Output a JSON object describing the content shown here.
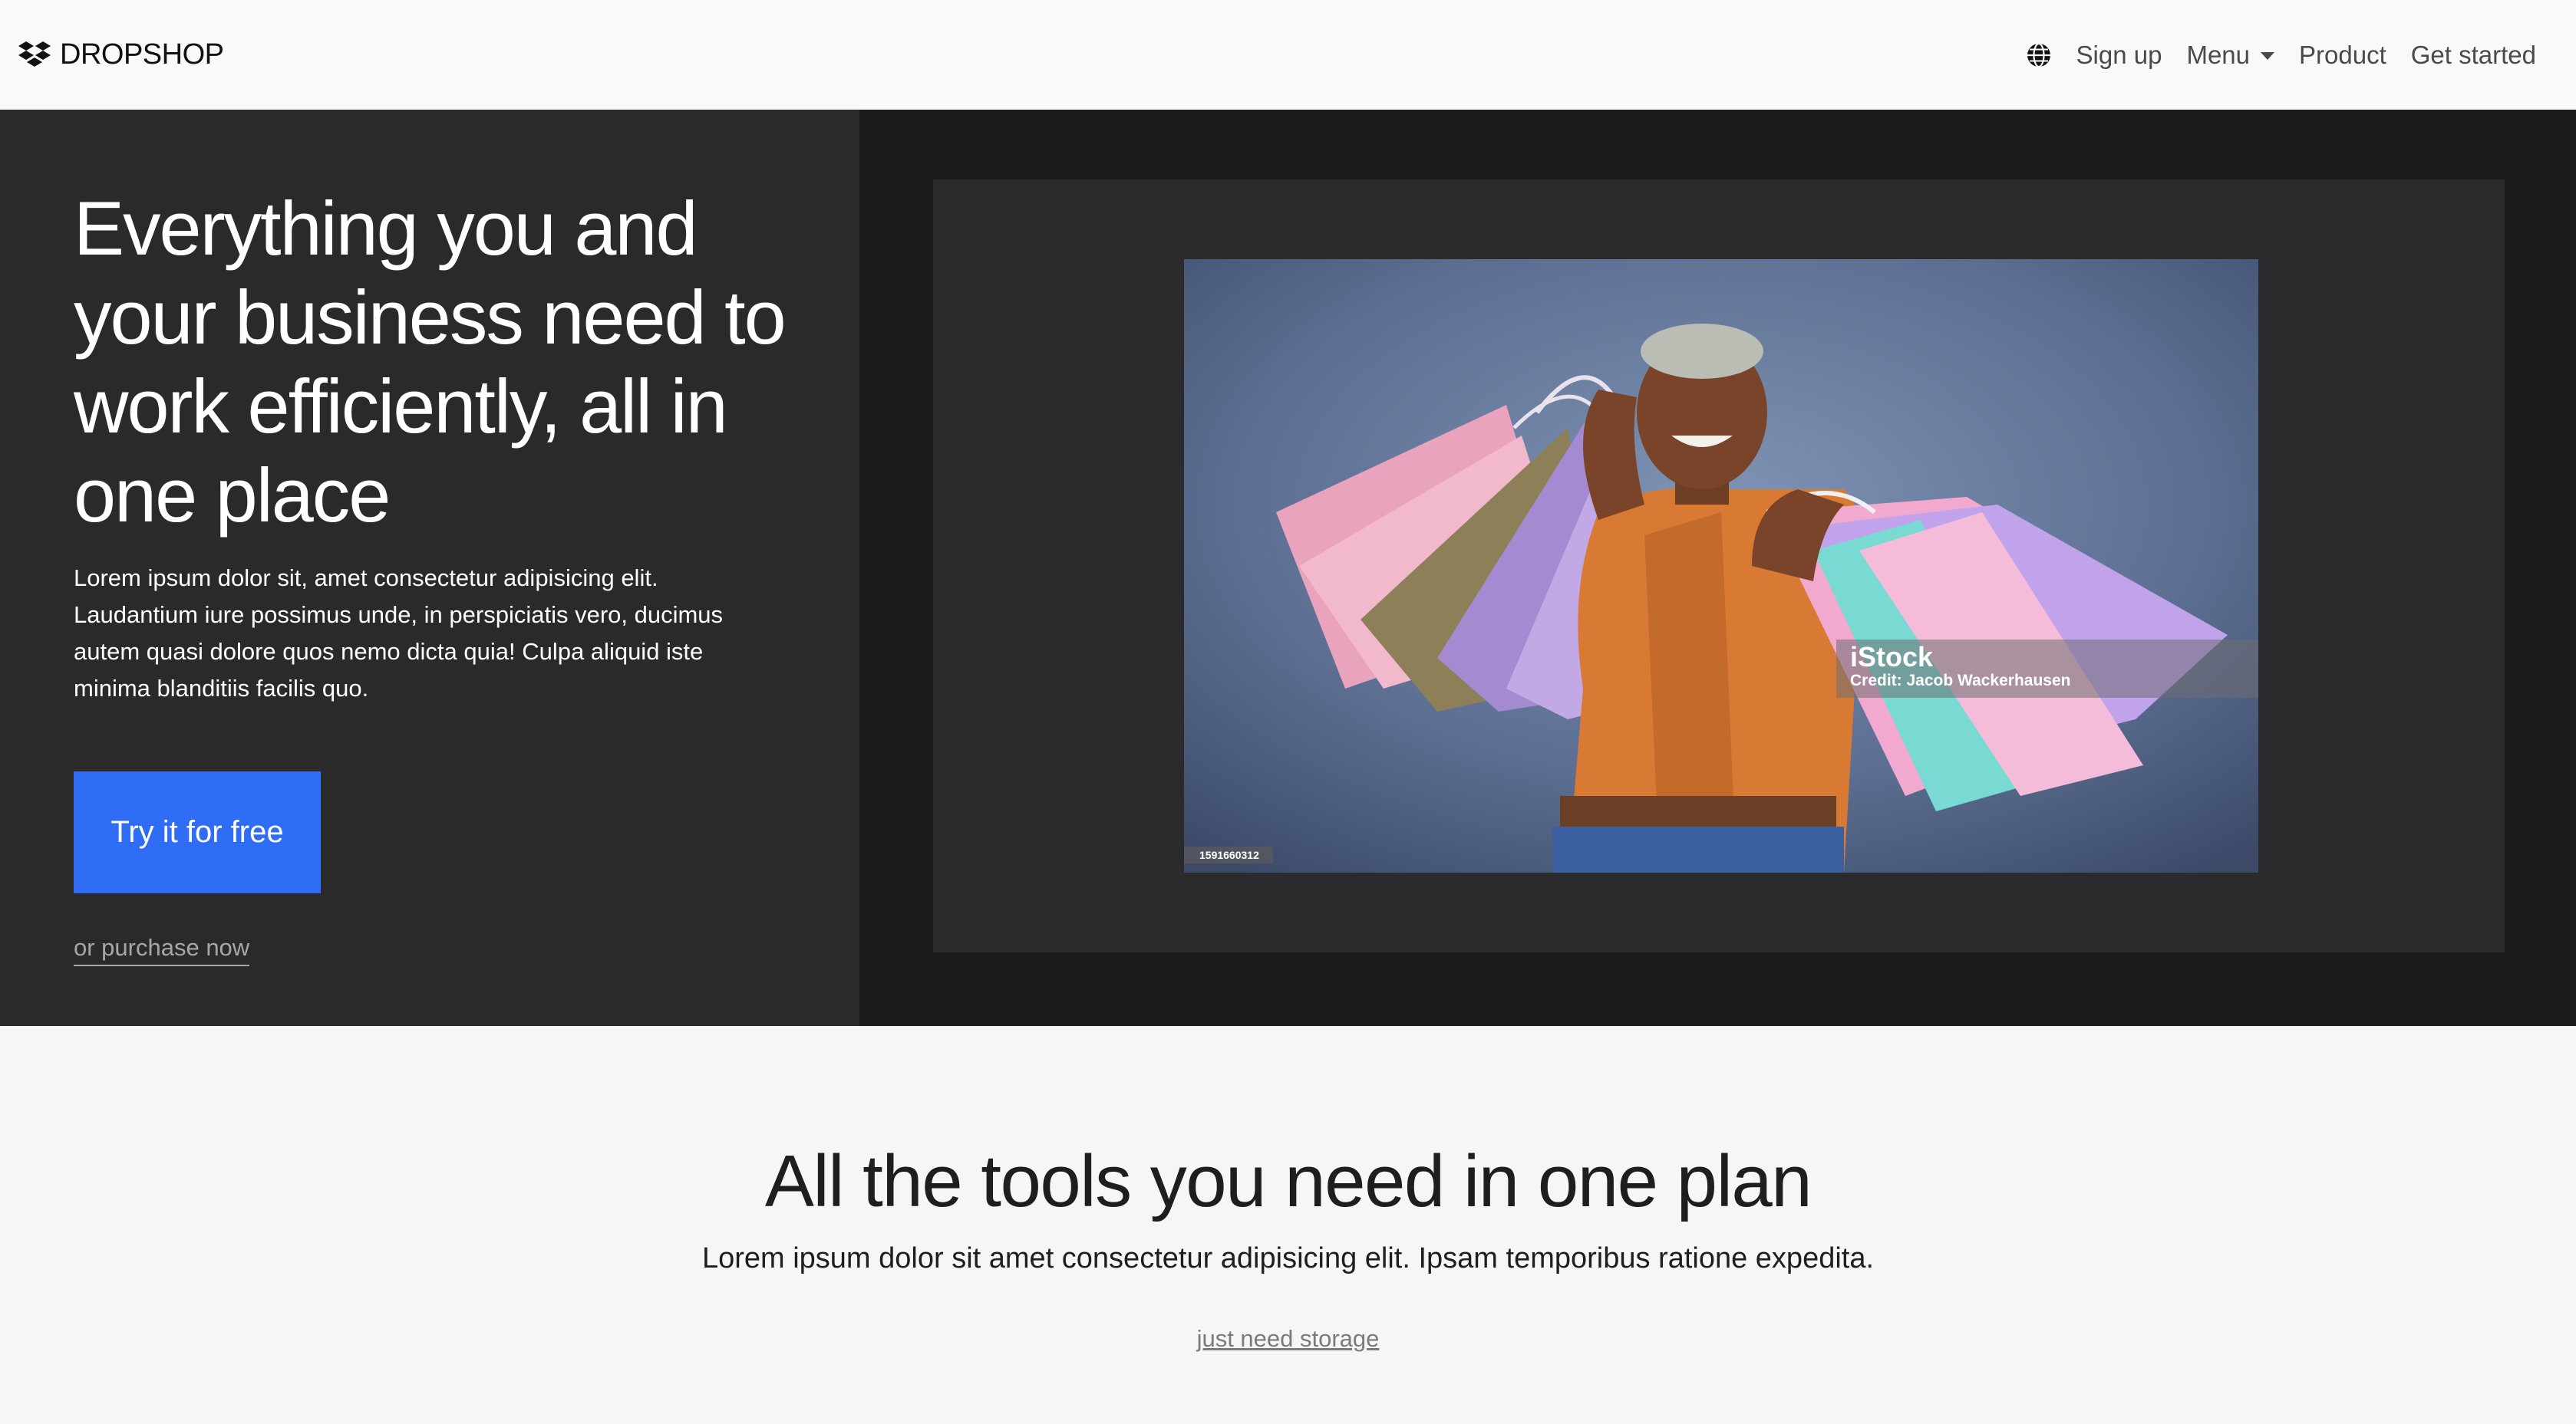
{
  "navbar": {
    "brand": "DROPSHOP",
    "links": {
      "signup": "Sign up",
      "menu": "Menu",
      "product": "Product",
      "get_started": "Get started"
    }
  },
  "hero": {
    "title": "Everything you and your business need to work efficiently, all in one place",
    "text": "Lorem ipsum dolor sit, amet consectetur adipisicing elit. Laudantium iure possimus unde, in perspiciatis vero, ducimus autem quasi dolore quos nemo dicta quia! Culpa aliquid iste minima blanditiis facilis quo.",
    "cta_label": "Try it for free",
    "purchase_label": "or purchase now",
    "image": {
      "watermark_brand": "iStock",
      "watermark_credit": "Credit: Jacob Wackerhausen",
      "image_id": "1591660312"
    }
  },
  "tools": {
    "title": "All the tools you need in one plan",
    "subtitle": "Lorem ipsum dolor sit amet consectetur adipisicing elit. Ipsam temporibus ratione expedita.",
    "storage_link": "just need storage"
  },
  "colors": {
    "navbar_bg": "#f8f9fa",
    "hero_left_bg": "#2a292b",
    "hero_right_bg": "#1c1b19",
    "cta_bg": "#2f6df6",
    "section_bg": "#f7f6f4"
  },
  "icons": {
    "brand_logo": "dropbox-logo-icon",
    "language": "globe-icon",
    "menu_toggle": "caret-down-icon"
  }
}
